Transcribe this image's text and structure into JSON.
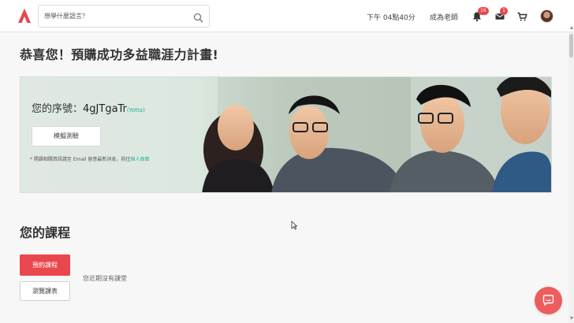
{
  "brand": {
    "logo_icon": "brand-a-logo-icon",
    "accent_color": "#e8474d"
  },
  "header": {
    "search_placeholder": "想學什麼語言？",
    "time_text": "下午 04點40分",
    "become_teacher_label": "成為老師",
    "notifications": {
      "icon": "bell-icon",
      "count": "16"
    },
    "messages": {
      "icon": "mail-icon",
      "count": "1"
    },
    "cart_icon": "cart-icon",
    "avatar_icon": "user-avatar"
  },
  "main": {
    "page_title": "恭喜您！預購成功多益職涯力計畫!",
    "banner": {
      "serial_label": "您的序號：",
      "serial_code": "4gJTgaTr",
      "serial_note_open": "(",
      "serial_note": "Yotta",
      "serial_note_close": ")",
      "mock_exam_button": "模擬測驗",
      "notice_text": "* 開課相關資訊請至 Email 留意最新消息，前往",
      "notice_link": "個人頁面"
    },
    "courses": {
      "section_title": "您的課程",
      "book_button": "預約課程",
      "browse_button": "瀏覽課表",
      "empty_message": "您近期沒有課堂"
    }
  },
  "chat_widget": {
    "icon": "chat-bubble-icon",
    "color": "#ee5d5d"
  }
}
